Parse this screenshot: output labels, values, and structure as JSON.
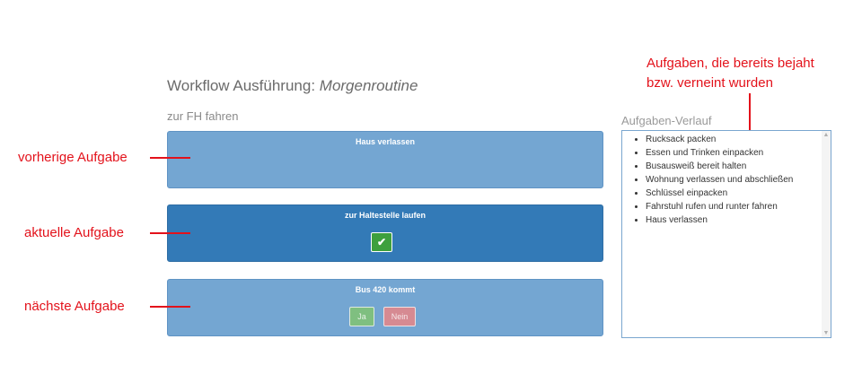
{
  "header": {
    "title_prefix": "Workflow Ausführung: ",
    "title_name": "Morgenroutine",
    "subtitle": "zur FH fahren"
  },
  "tasks": {
    "previous": {
      "label": "Haus verlassen"
    },
    "current": {
      "label": "zur Haltestelle laufen",
      "confirm_icon": "check-icon"
    },
    "next": {
      "label": "Bus 420 kommt",
      "yes_label": "Ja",
      "no_label": "Nein"
    }
  },
  "history": {
    "heading": "Aufgaben-Verlauf",
    "items": [
      "Rucksack packen",
      "Essen und Trinken einpacken",
      "Busausweiß bereit halten",
      "Wohnung verlassen und abschließen",
      "Schlüssel einpacken",
      "Fahrstuhl rufen und runter fahren",
      "Haus verlassen"
    ]
  },
  "annotations": {
    "previous": "vorherige Aufgabe",
    "current": "aktuelle Aufgabe",
    "next": "nächste Aufgabe",
    "history_line1": "Aufgaben, die bereits bejaht",
    "history_line2": "bzw. verneint wurden"
  },
  "colors": {
    "annotation": "#e3121b",
    "task_primary": "#337ab7",
    "task_light": "#74a6d2",
    "success": "#3ea03e",
    "danger": "#d68a92"
  }
}
